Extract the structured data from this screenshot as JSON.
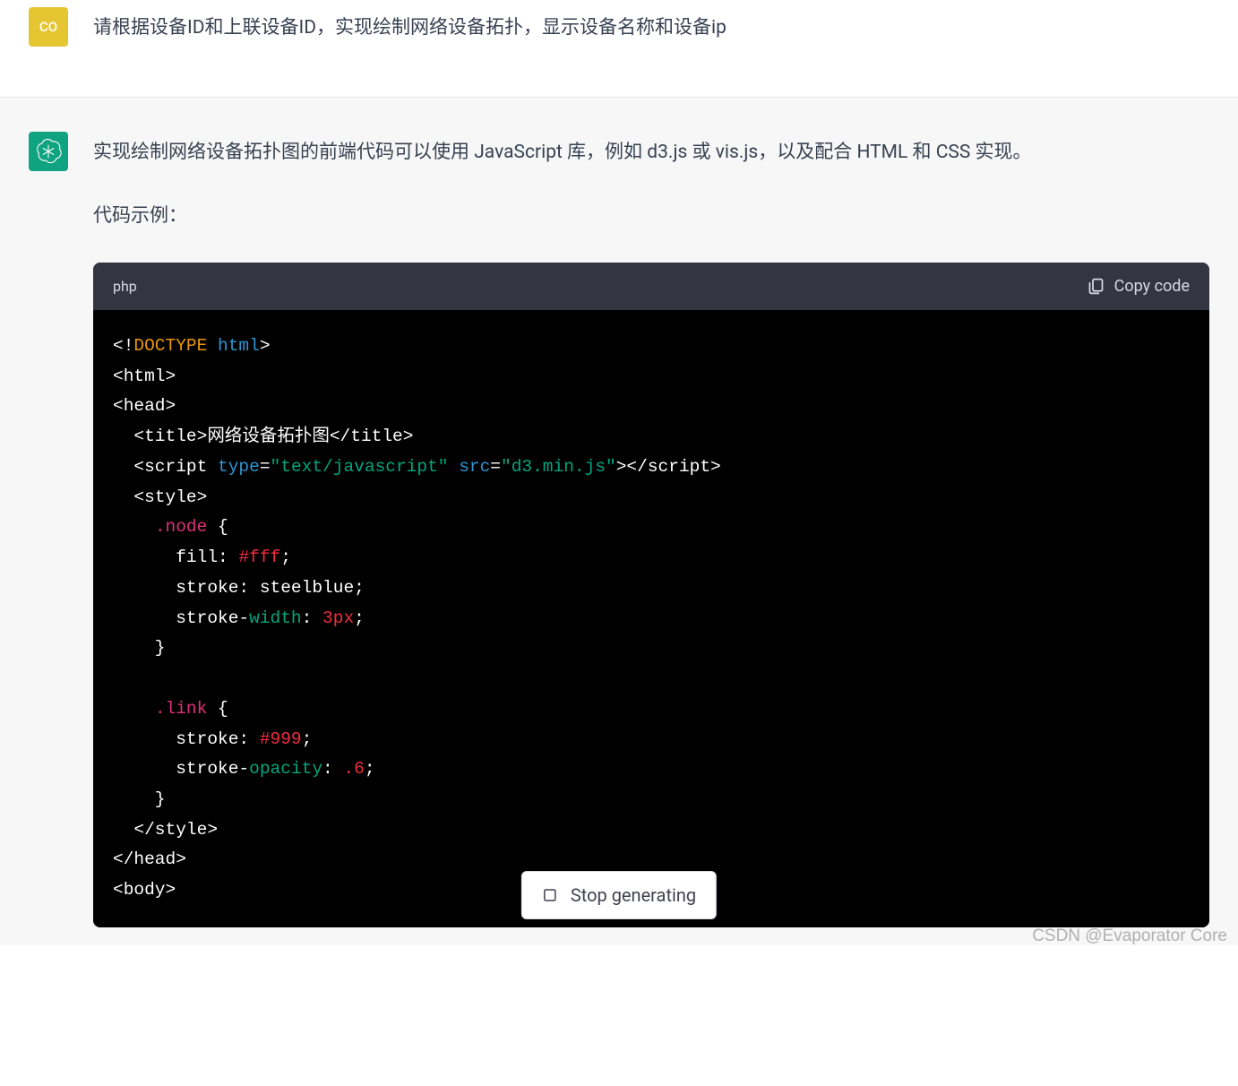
{
  "user": {
    "avatar_label": "CO",
    "message": "请根据设备ID和上联设备ID，实现绘制网络设备拓扑，显示设备名称和设备ip"
  },
  "assistant": {
    "response_p1": "实现绘制网络设备拓扑图的前端代码可以使用 JavaScript 库，例如 d3.js 或 vis.js，以及配合 HTML 和 CSS 实现。",
    "response_p2": "代码示例：",
    "code": {
      "language": "php",
      "copy_label": "Copy code",
      "tokens": {
        "t1": "<!",
        "t2": "DOCTYPE",
        "t3": " ",
        "t4": "html",
        "t5": ">",
        "t6": "<html>",
        "t7": "<head>",
        "t8": "  ",
        "t9": "<title>",
        "t10": "网络设备拓扑图",
        "t11": "</title>",
        "t12": "  <script ",
        "t13": "type",
        "t14": "=",
        "t15": "\"text/javascript\"",
        "t16": " ",
        "t17": "src",
        "t18": "=",
        "t19": "\"d3.min.js\"",
        "t20": "></script>",
        "t21": "  <style>",
        "t22": "    ",
        "t23": ".node",
        "t24": " {",
        "t25": "      fill: ",
        "t26": "#fff",
        "t27": ";",
        "t28": "      stroke: steelblue;",
        "t29": "      stroke-",
        "t30": "width",
        "t31": ": ",
        "t32": "3px",
        "t33": ";",
        "t34": "    }",
        "t35": "    ",
        "t36": ".link",
        "t37": " {",
        "t38": "      stroke: ",
        "t39": "#999",
        "t40": ";",
        "t41": "      stroke-",
        "t42": "opacity",
        "t43": ": ",
        "t44": ".6",
        "t45": ";",
        "t46": "    }",
        "t47": "  </style>",
        "t48": "</head>",
        "t49": "<body>"
      }
    }
  },
  "controls": {
    "stop_label": "Stop generating"
  },
  "watermark": "CSDN @Evaporator Core"
}
